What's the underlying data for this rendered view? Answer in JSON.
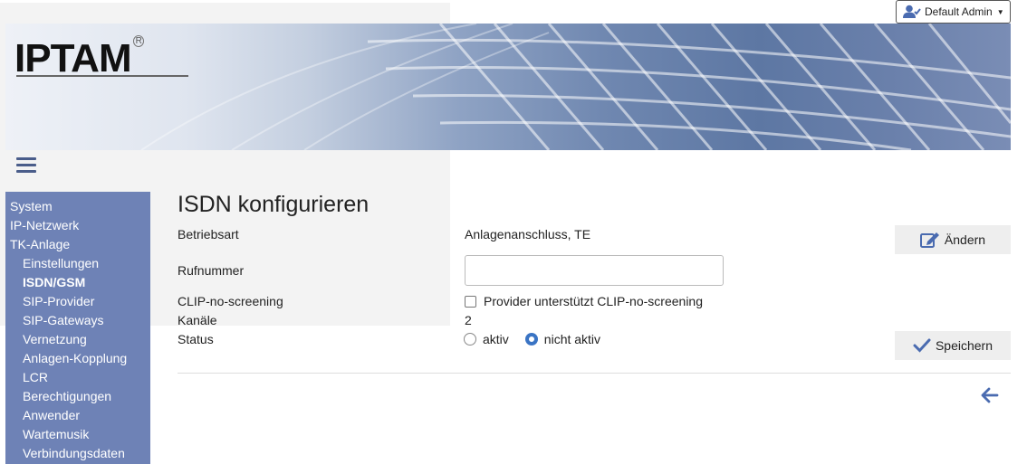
{
  "header": {
    "user_label": "Default Admin",
    "logo_text": "IPTAM",
    "logo_mark": "R"
  },
  "sidebar": {
    "items": [
      {
        "label": "System",
        "level": 0
      },
      {
        "label": "IP-Netzwerk",
        "level": 0
      },
      {
        "label": "TK-Anlage",
        "level": 0
      },
      {
        "label": "Einstellungen",
        "level": 1
      },
      {
        "label": "ISDN/GSM",
        "level": 1,
        "active": true
      },
      {
        "label": "SIP-Provider",
        "level": 1
      },
      {
        "label": "SIP-Gateways",
        "level": 1
      },
      {
        "label": "Vernetzung",
        "level": 1
      },
      {
        "label": "Anlagen-Kopplung",
        "level": 1
      },
      {
        "label": "LCR",
        "level": 1
      },
      {
        "label": "Berechtigungen",
        "level": 1
      },
      {
        "label": "Anwender",
        "level": 1
      },
      {
        "label": "Wartemusik",
        "level": 1
      },
      {
        "label": "Verbindungsdaten",
        "level": 1
      }
    ]
  },
  "main": {
    "title": "ISDN konfigurieren",
    "betriebsart_label": "Betriebsart",
    "betriebsart_value": "Anlagenanschluss, TE",
    "rufnummer_label": "Rufnummer",
    "rufnummer_value": "",
    "clip_label": "CLIP-no-screening",
    "clip_checkbox_label": "Provider unterstützt CLIP-no-screening",
    "clip_checked": false,
    "kanaele_label": "Kanäle",
    "kanaele_value": "2",
    "status_label": "Status",
    "status_options": [
      "aktiv",
      "nicht aktiv"
    ],
    "status_selected": "nicht aktiv",
    "edit_button": "Ändern",
    "save_button": "Speichern"
  },
  "colors": {
    "sidebar_bg": "#6e82b6",
    "accent": "#4a6bb0",
    "radio_selected": "#3a74c4"
  },
  "icons": [
    "user-check-icon",
    "caret-down-icon",
    "menu-icon",
    "edit-icon",
    "check-icon",
    "arrow-left-icon"
  ]
}
